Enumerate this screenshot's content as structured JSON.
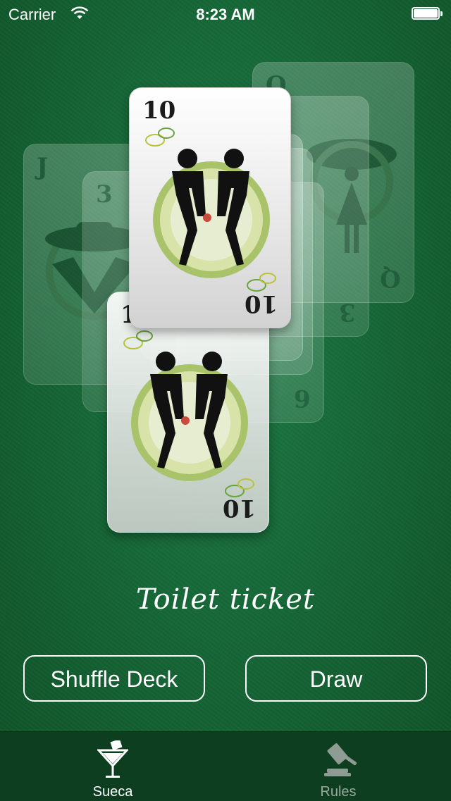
{
  "status_bar": {
    "carrier": "Carrier",
    "time": "8:23 AM"
  },
  "cards": {
    "front_rank": "10",
    "lower_rank": "10",
    "ghost_ranks": [
      "J",
      "3",
      "Q",
      "6"
    ]
  },
  "caption": "Toilet ticket",
  "buttons": {
    "shuffle": "Shuffle Deck",
    "draw": "Draw"
  },
  "tabs": [
    {
      "label": "Sueca",
      "icon": "cocktail-glass-icon",
      "selected": true
    },
    {
      "label": "Rules",
      "icon": "gavel-icon",
      "selected": false
    }
  ]
}
